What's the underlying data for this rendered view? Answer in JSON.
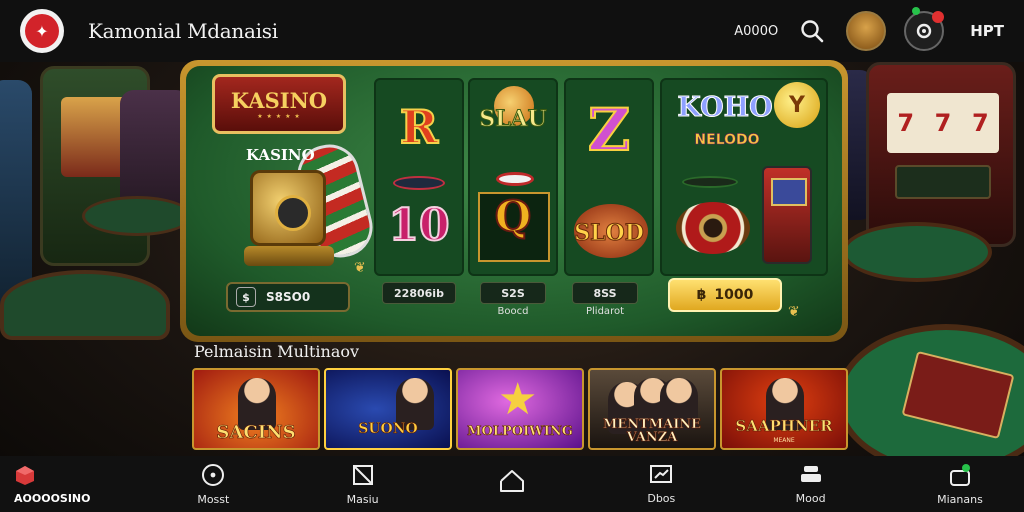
{
  "header": {
    "title": "Kamonial Mdanaisi",
    "balance": "A000O",
    "profile_label": "HPT"
  },
  "hero": {
    "logo_text": "KASINO",
    "vault_label": "KASINO",
    "reel_symbols": {
      "r": "R",
      "ten": "10",
      "slau": "SLAU",
      "q": "Q",
      "z": "Z",
      "slod": "SLOD",
      "koho": "KOHO",
      "nelodo": "NELODO",
      "coin": "Y"
    },
    "bet_symbol": "$",
    "bet_value": "S8SO0",
    "pill1": "22806ib",
    "pill2": "S2S",
    "pill2_sub": "Boocd",
    "pill3": "8SS",
    "pill3_sub": "Plidarot",
    "win_symbol": "฿",
    "win_value": "1000"
  },
  "featured": {
    "title": "Pelmaisin Multinaov",
    "games": [
      {
        "title": "SACINS"
      },
      {
        "title": "SUONO"
      },
      {
        "title": "MOLPOIWING"
      },
      {
        "title": "MENTMAINE VANZA"
      },
      {
        "title": "SAAPHNER",
        "subtitle": "MEANE"
      }
    ]
  },
  "nav": {
    "items": [
      {
        "label": "AOOOOSINO",
        "icon": "home-cube-icon"
      },
      {
        "label": "Mosst",
        "icon": "compass-icon"
      },
      {
        "label": "Masiu",
        "icon": "map-icon"
      },
      {
        "label": "",
        "icon": "house-icon"
      },
      {
        "label": "Dbos",
        "icon": "chart-icon"
      },
      {
        "label": "Mood",
        "icon": "stack-icon"
      },
      {
        "label": "Mianans",
        "icon": "lock-icon"
      }
    ]
  },
  "colors": {
    "accent_gold": "#c8962e",
    "felt_green": "#1f5a2a",
    "alert_red": "#e03030"
  }
}
